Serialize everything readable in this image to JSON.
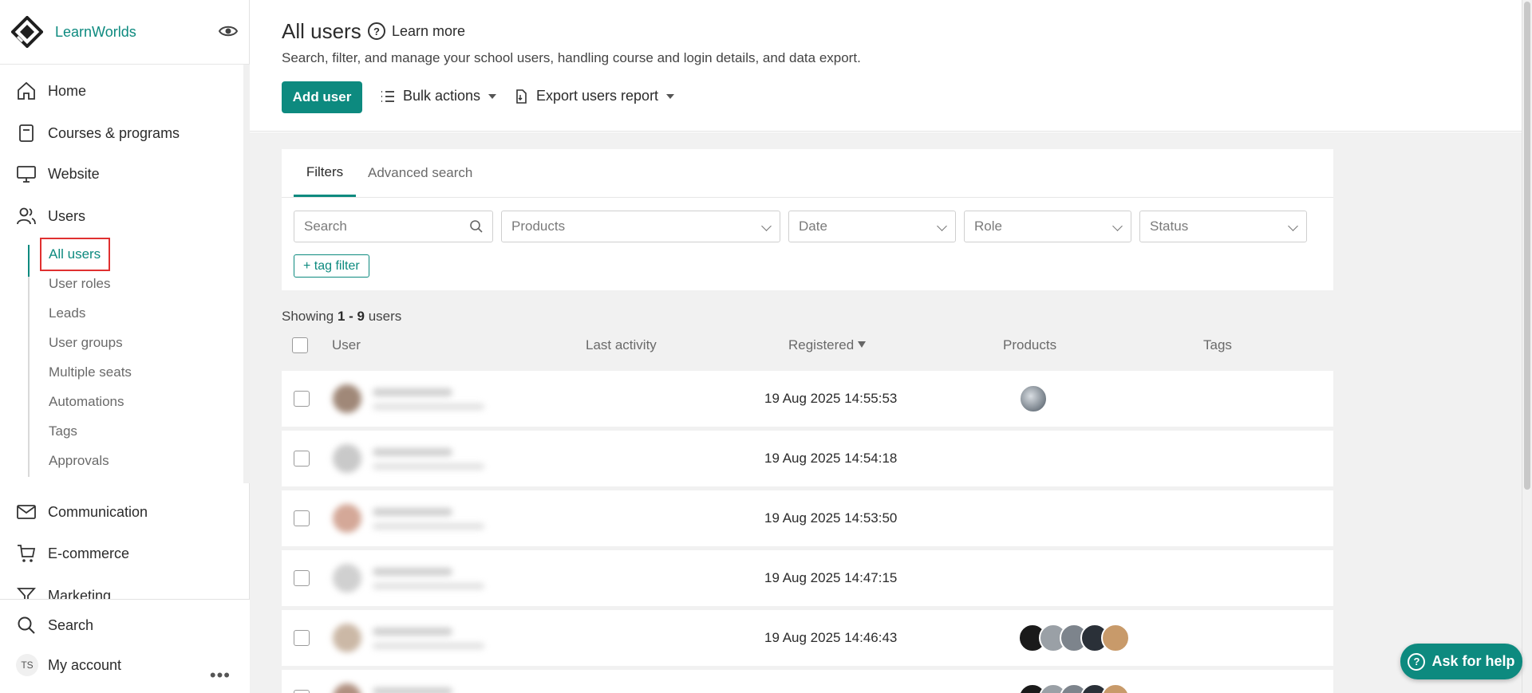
{
  "brand": {
    "name": "LearnWorlds"
  },
  "nav": {
    "items": [
      {
        "label": "Home",
        "icon": "home-icon"
      },
      {
        "label": "Courses & programs",
        "icon": "book-icon"
      },
      {
        "label": "Website",
        "icon": "monitor-icon"
      },
      {
        "label": "Users",
        "icon": "users-icon"
      },
      {
        "label": "Communication",
        "icon": "mail-icon"
      },
      {
        "label": "E-commerce",
        "icon": "cart-icon"
      },
      {
        "label": "Marketing",
        "icon": "funnel-icon"
      }
    ],
    "users_sub": [
      "All users",
      "User roles",
      "Leads",
      "User groups",
      "Multiple seats",
      "Automations",
      "Tags",
      "Approvals"
    ],
    "bottom": {
      "search": "Search",
      "account": "My account",
      "initials": "TS"
    }
  },
  "header": {
    "title": "All users",
    "learn_more": "Learn more",
    "subtitle": "Search, filter, and manage your school users, handling course and login details, and data export.",
    "add_user": "Add user",
    "bulk_actions": "Bulk actions",
    "export": "Export users report"
  },
  "filters": {
    "tabs": [
      "Filters",
      "Advanced search"
    ],
    "search_placeholder": "Search",
    "products": "Products",
    "date": "Date",
    "role": "Role",
    "status": "Status",
    "tag_filter": "+ tag filter"
  },
  "table": {
    "showing_prefix": "Showing",
    "showing_range": "1 - 9",
    "showing_suffix": "users",
    "columns": [
      "User",
      "Last activity",
      "Registered",
      "Products",
      "Tags"
    ],
    "rows": [
      {
        "registered": "19 Aug 2025 14:55:53",
        "products": 1
      },
      {
        "registered": "19 Aug 2025 14:54:18",
        "products": 0
      },
      {
        "registered": "19 Aug 2025 14:53:50",
        "products": 0
      },
      {
        "registered": "19 Aug 2025 14:47:15",
        "products": 0
      },
      {
        "registered": "19 Aug 2025 14:46:43",
        "products": 5
      },
      {
        "registered": "",
        "products": 5
      }
    ]
  },
  "help": {
    "label": "Ask for help"
  },
  "colors": {
    "accent": "#0d8a7f",
    "highlight_box": "#e03030"
  }
}
